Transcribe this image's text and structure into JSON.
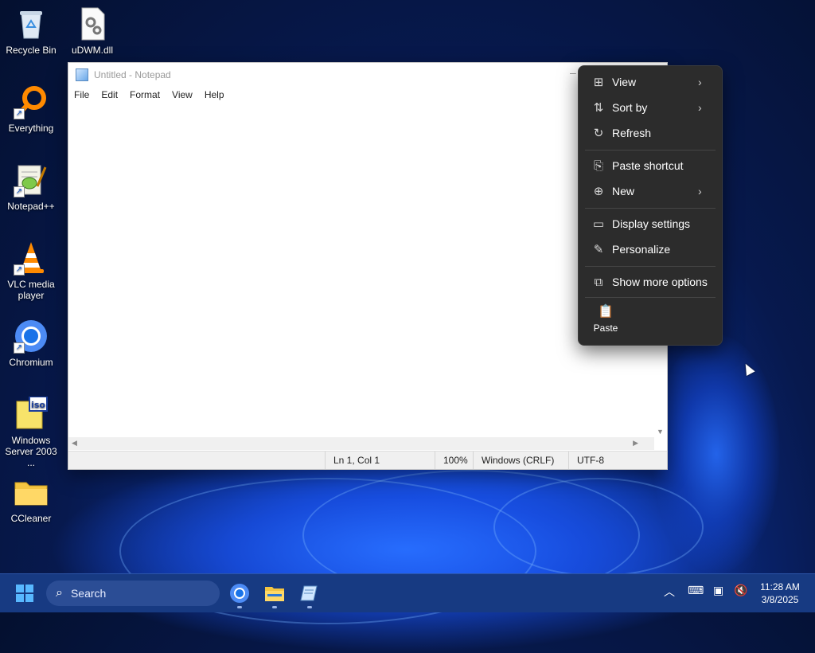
{
  "desktop": {
    "icons": [
      {
        "label": "Recycle Bin",
        "icon": "recycle-bin-icon"
      },
      {
        "label": "uDWM.dll",
        "icon": "dll-file-icon"
      },
      {
        "label": "Everything",
        "icon": "everything-search-icon"
      },
      {
        "label": "Notepad++",
        "icon": "notepad-plus-plus-icon"
      },
      {
        "label": "VLC media player",
        "icon": "vlc-cone-icon"
      },
      {
        "label": "Chromium",
        "icon": "chromium-icon"
      },
      {
        "label": "Windows Server 2003 ...",
        "icon": "iso-file-icon"
      },
      {
        "label": "CCleaner",
        "icon": "folder-icon"
      }
    ]
  },
  "notepad": {
    "title": "Untitled - Notepad",
    "menu": [
      "File",
      "Edit",
      "Format",
      "View",
      "Help"
    ],
    "status": {
      "position": "Ln 1, Col 1",
      "zoom": "100%",
      "line_endings": "Windows (CRLF)",
      "encoding": "UTF-8"
    }
  },
  "context_menu": {
    "items": [
      {
        "label": "View",
        "icon": "view-grid-icon",
        "submenu": true
      },
      {
        "label": "Sort by",
        "icon": "sort-icon",
        "submenu": true
      },
      {
        "label": "Refresh",
        "icon": "refresh-icon",
        "submenu": false
      },
      {
        "label": "Paste shortcut",
        "icon": "paste-shortcut-icon",
        "submenu": false
      },
      {
        "label": "New",
        "icon": "new-plus-icon",
        "submenu": true
      },
      {
        "label": "Display settings",
        "icon": "display-icon",
        "submenu": false
      },
      {
        "label": "Personalize",
        "icon": "pen-icon",
        "submenu": false
      },
      {
        "label": "Show more options",
        "icon": "more-options-icon",
        "submenu": false
      }
    ],
    "paste_label": "Paste"
  },
  "taskbar": {
    "search_label": "Search",
    "time": "11:28 AM",
    "date": "3/8/2025"
  },
  "colors": {
    "taskbar": "#173a82",
    "menu_bg": "#2c2c2c",
    "accent": "#58b8ff"
  }
}
